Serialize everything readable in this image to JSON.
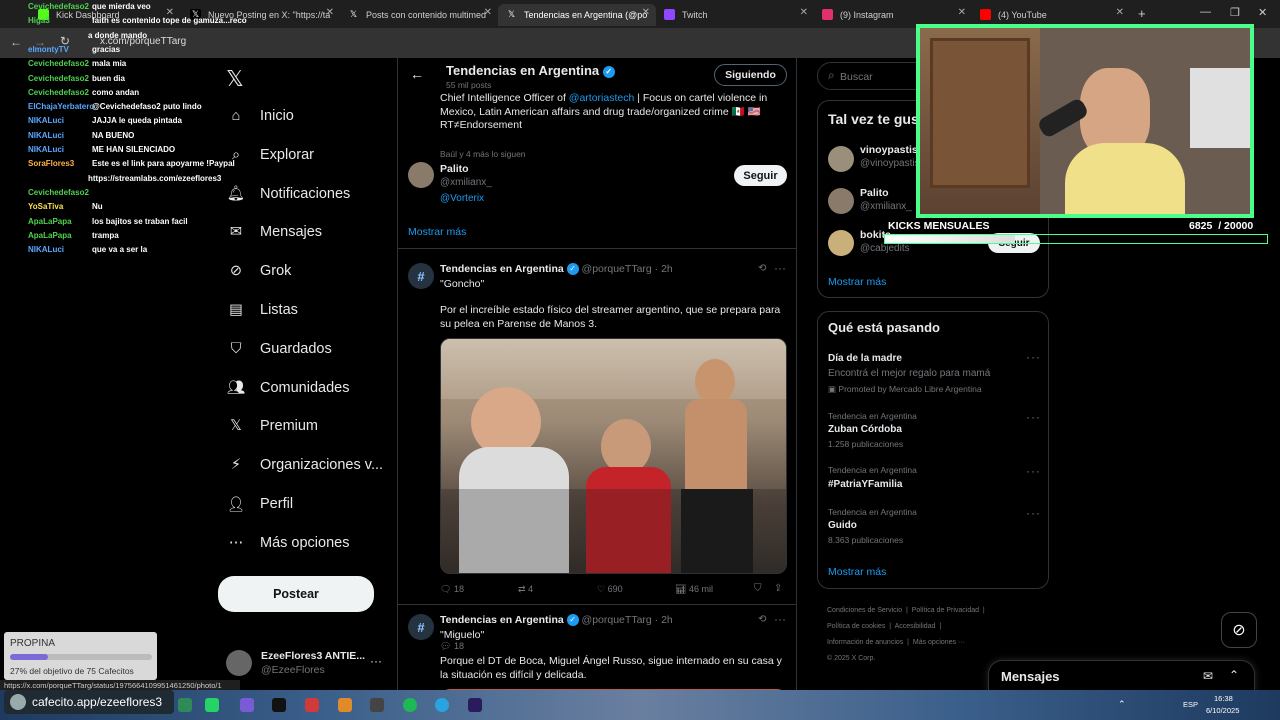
{
  "browser": {
    "tabs": [
      {
        "label": "Kick Dashboard",
        "fav": "#53fc18"
      },
      {
        "label": "Nuevo Posting en X: \"https://ta",
        "fav": "#fff"
      },
      {
        "label": "Posts con contenido multimed",
        "fav": "#fff"
      },
      {
        "label": "Tendencias en Argentina (@po",
        "fav": "#fff"
      },
      {
        "label": "Twitch",
        "fav": "#9146ff"
      },
      {
        "label": "(9) Instagram",
        "fav": "#e1306c"
      },
      {
        "label": "(4) YouTube",
        "fav": "#ff0000"
      }
    ],
    "url": "x.com/porqueTTarg"
  },
  "chat": [
    {
      "user": "Cevichedefaso2",
      "msg": "que mierda veo",
      "color": "#4fd14f"
    },
    {
      "user": "Higa3",
      "msg": "faith es contenido tope de gamuza...reco",
      "color": "#4fd14f"
    },
    {
      "user": "",
      "msg": "a donde mando",
      "color": "#4fd14f"
    },
    {
      "user": "elmontyTV",
      "msg": "gracias",
      "color": "#5aa8ff"
    },
    {
      "user": "Cevichedefaso2",
      "msg": "mala mia",
      "color": "#4fd14f"
    },
    {
      "user": "Cevichedefaso2",
      "msg": "buen dia",
      "color": "#4fd14f"
    },
    {
      "user": "Cevichedefaso2",
      "msg": "como andan",
      "color": "#4fd14f"
    },
    {
      "user": "ElChajaYerbatero",
      "msg": "@Cevichedefaso2 puto lindo",
      "color": "#5aa8ff"
    },
    {
      "user": "NIKALuci",
      "msg": "JAJJA le queda pintada",
      "color": "#5aa8ff"
    },
    {
      "user": "NIKALuci",
      "msg": "NA BUENO",
      "color": "#5aa8ff"
    },
    {
      "user": "NIKALuci",
      "msg": "ME HAN SILENCIADO",
      "color": "#5aa8ff"
    },
    {
      "user": "SoraFlores3",
      "msg": "Este es el link para apoyarme !Paypal",
      "color": "#ffb347"
    },
    {
      "user": "",
      "msg": "https://streamlabs.com/ezeeflores3",
      "color": "#ffb347"
    },
    {
      "user": "Cevichedefaso2",
      "msg": "",
      "color": "#4fd14f"
    },
    {
      "user": "YoSaTiva",
      "msg": "Nu",
      "color": "#ffe14d"
    },
    {
      "user": "ApaLaPapa",
      "msg": "los bajitos se traban facil",
      "color": "#4fd14f"
    },
    {
      "user": "ApaLaPapa",
      "msg": "trampa",
      "color": "#4fd14f"
    },
    {
      "user": "NIKALuci",
      "msg": "que va a ser la",
      "color": "#5aa8ff"
    }
  ],
  "nav": [
    {
      "label": "Inicio",
      "icon": "home-icon",
      "glyph": "⌂"
    },
    {
      "label": "Explorar",
      "icon": "search-icon",
      "glyph": "⌕"
    },
    {
      "label": "Notificaciones",
      "icon": "bell-icon",
      "glyph": "🔔︎"
    },
    {
      "label": "Mensajes",
      "icon": "mail-icon",
      "glyph": "✉"
    },
    {
      "label": "Grok",
      "icon": "grok-icon",
      "glyph": "⊘"
    },
    {
      "label": "Listas",
      "icon": "list-icon",
      "glyph": "▤"
    },
    {
      "label": "Guardados",
      "icon": "bookmark-icon",
      "glyph": "⛉"
    },
    {
      "label": "Comunidades",
      "icon": "communities-icon",
      "glyph": "👥︎"
    },
    {
      "label": "Premium",
      "icon": "premium-icon",
      "glyph": "𝕏"
    },
    {
      "label": "Organizaciones v...",
      "icon": "lightning-icon",
      "glyph": "⚡︎"
    },
    {
      "label": "Perfil",
      "icon": "person-icon",
      "glyph": "👤︎"
    },
    {
      "label": "Más opciones",
      "icon": "more-icon",
      "glyph": "⋯"
    }
  ],
  "post_button": "Postear",
  "account": {
    "name": "EzeeFlores3 ANTIE...",
    "handle": "@EzeeFlores"
  },
  "header": {
    "title": "Tendencias en Argentina",
    "subtitle": "55 mil posts",
    "follow_button": "Siguiendo"
  },
  "bio": {
    "text1": "Chief Intelligence Officer of ",
    "mention": "@artoriastech",
    "text2": " | Focus on cartel violence in Mexico, Latin American affairs and drug trade/organized crime 🇲🇽 🇺🇸 RT≠Endorsement"
  },
  "suggestion": {
    "followers": "Baúl y 4 más lo siguen",
    "name": "Palito",
    "handle": "@xmilianx_",
    "link": "@Vorterix",
    "button": "Seguir"
  },
  "show_more": "Mostrar más",
  "tweets": [
    {
      "name": "Tendencias en Argentina",
      "handle": "@porqueTTarg",
      "time": "· 2h",
      "title": "\"Goncho\"",
      "body": "Por el increíble estado físico del streamer argentino, que se prepara para su pelea en Parense de Manos 3.",
      "replies": "18",
      "retweets": "4",
      "likes": "690",
      "views": "46 mil"
    },
    {
      "name": "Tendencias en Argentina",
      "handle": "@porqueTTarg",
      "time": "· 2h",
      "title": "\"Miguelo\"",
      "body": "Porque el DT de Boca, Miguel Ángel Russo, sigue internado en su casa y la situación es difícil y delicada."
    }
  ],
  "search_placeholder": "Buscar",
  "who_to_follow": {
    "title": "Tal vez te gust",
    "users": [
      {
        "name": "vinoypastis",
        "handle": "@vinoypastis"
      },
      {
        "name": "Palito",
        "handle": "@xmilianx_"
      },
      {
        "name": "bokita...",
        "handle": "@cabjedits"
      }
    ],
    "button": "Seguir",
    "more": "Mostrar más"
  },
  "trends": {
    "title": "Qué está pasando",
    "items": [
      {
        "category": "",
        "name": "Día de la madre",
        "sub": "Encontrá el mejor regalo para mamá",
        "promo": "Promoted by Mercado Libre Argentina"
      },
      {
        "category": "Tendencia en Argentina",
        "name": "Zuban Córdoba",
        "sub": "1.258 publicaciones"
      },
      {
        "category": "Tendencia en Argentina",
        "name": "#PatriaYFamilia",
        "sub": ""
      },
      {
        "category": "Tendencia en Argentina",
        "name": "Guido",
        "sub": "8.363 publicaciones"
      }
    ],
    "more": "Mostrar más"
  },
  "footer": {
    "links1": "Condiciones de Servicio  |  Política de Privacidad  |",
    "links2": "Política de cookies  |  Accesibilidad  |",
    "links3": "Información de anuncios  |  Más opciones ···",
    "copy": "© 2025 X Corp."
  },
  "kicks": {
    "label": "KICKS MENSUALES",
    "value": "6825",
    "goal": "/ 20000",
    "fill": 0.34
  },
  "messages_drawer": "Mensajes",
  "propina": {
    "title": "PROPINA",
    "text": "27% del objetivo de 75 Cafecitos",
    "fill": 0.27
  },
  "cafecito": "cafecito.app/ezeeflores3",
  "status_url": "https://x.com/porqueTTarg/status/1975664109951461250/photo/1",
  "clock": {
    "time": "16:38",
    "date": "6/10/2025",
    "lang": "ESP"
  }
}
